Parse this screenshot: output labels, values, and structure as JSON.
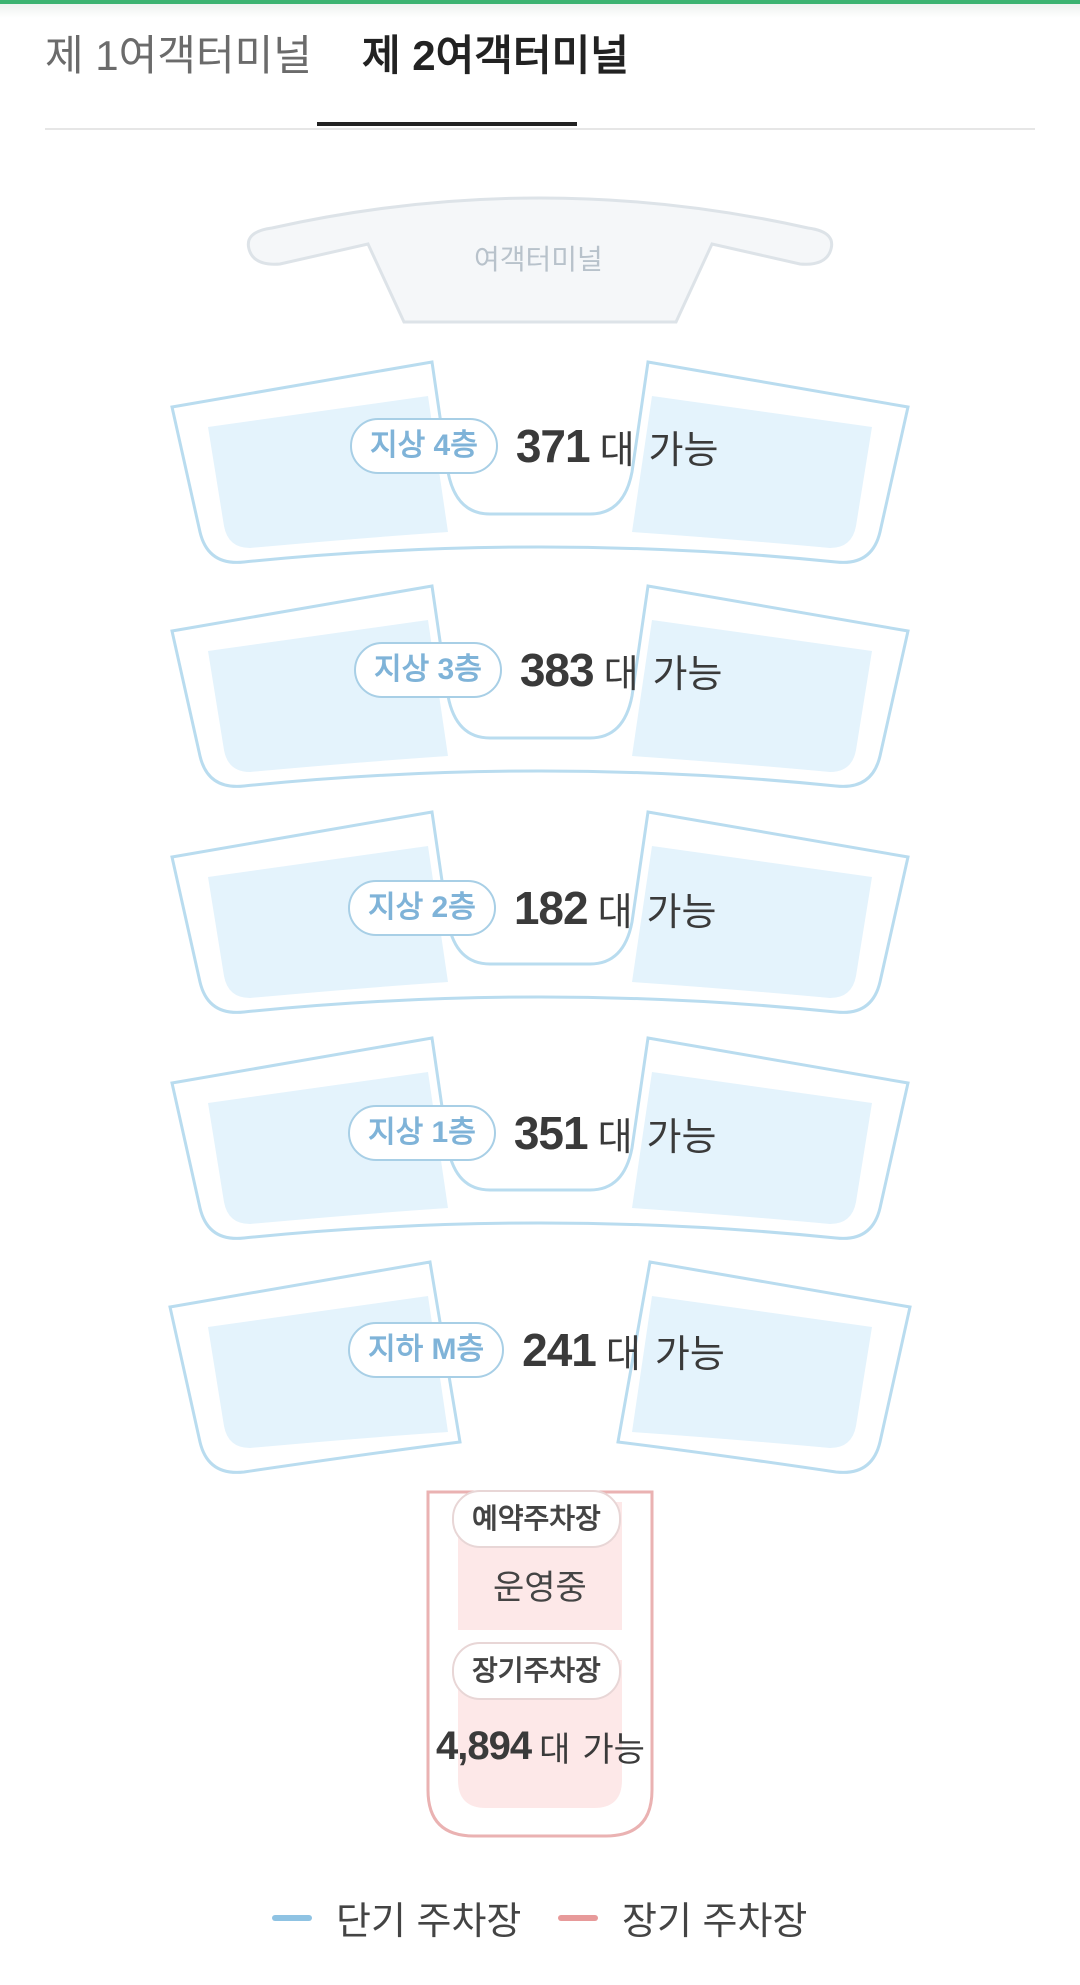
{
  "tabs": [
    {
      "label": "제 1여객터미널",
      "active": false
    },
    {
      "label": "제 2여객터미널",
      "active": true
    }
  ],
  "terminal_label": "여객터미널",
  "floors": [
    {
      "name": "지상 4층",
      "count": "371",
      "unit": "대",
      "status": "가능"
    },
    {
      "name": "지상 3층",
      "count": "383",
      "unit": "대",
      "status": "가능"
    },
    {
      "name": "지상 2층",
      "count": "182",
      "unit": "대",
      "status": "가능"
    },
    {
      "name": "지상 1층",
      "count": "351",
      "unit": "대",
      "status": "가능"
    },
    {
      "name": "지하 M층",
      "count": "241",
      "unit": "대",
      "status": "가능"
    }
  ],
  "reserved": {
    "label": "예약주차장",
    "status": "운영중"
  },
  "long_term": {
    "label": "장기주차장",
    "count": "4,894",
    "unit": "대",
    "status": "가능"
  },
  "legend": [
    {
      "label": "단기 주차장",
      "color": "#8fc3e3",
      "icon": "short-term-line"
    },
    {
      "label": "장기 주차장",
      "color": "#e79a9a",
      "icon": "long-term-line"
    }
  ],
  "colors": {
    "accent_top": "#3cb371",
    "short_term_outline": "#b9dcef",
    "short_term_fill": "#e4f3fc",
    "long_term_outline": "#eab2b2",
    "long_term_fill": "#fde8e8"
  }
}
